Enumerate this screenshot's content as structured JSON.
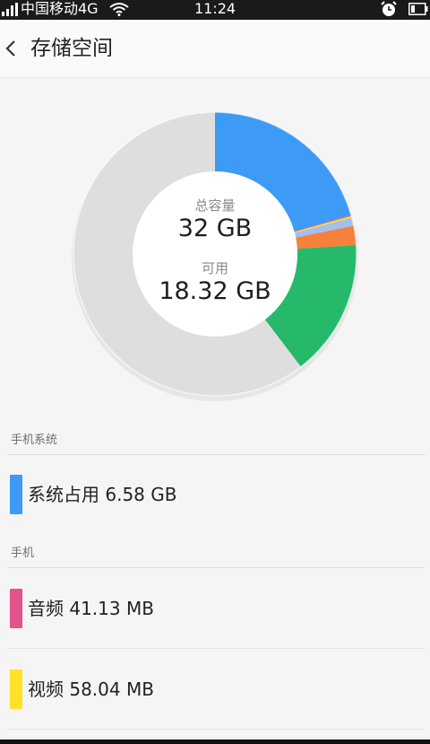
{
  "status_bar": {
    "carrier": "中国移动4G",
    "time": "11:24"
  },
  "header": {
    "title": "存储空间"
  },
  "storage": {
    "total_label": "总容量",
    "total_value": "32 GB",
    "available_label": "可用",
    "available_value": "18.32 GB"
  },
  "chart_data": {
    "type": "pie",
    "style": "donut",
    "total_gb": 32,
    "start_angle_deg": 0,
    "slices": [
      {
        "color": "#3d9bf5",
        "value": 6.58
      },
      {
        "color": "#e0558a",
        "value": 0.04
      },
      {
        "color": "#ffe12a",
        "value": 0.06
      },
      {
        "color": "#a3bff0",
        "value": 0.3
      },
      {
        "color": "#f5813a",
        "value": 0.7
      },
      {
        "color": "#26b96c",
        "value": 5.0
      },
      {
        "color": "#dedede",
        "value": 19.32
      }
    ]
  },
  "sections": [
    {
      "header": "手机系统",
      "items": [
        {
          "label": "系统占用 6.58 GB",
          "color": "#3d9bf5"
        }
      ]
    },
    {
      "header": "手机",
      "items": [
        {
          "label": "音频 41.13 MB",
          "color": "#e0558a"
        },
        {
          "label": "视频 58.04 MB",
          "color": "#ffe12a"
        }
      ]
    }
  ]
}
